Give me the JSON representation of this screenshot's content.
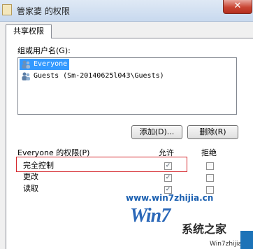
{
  "window": {
    "title": "管家婆 的权限",
    "close_label": "✕"
  },
  "tab": {
    "label": "共享权限"
  },
  "group": {
    "label": "组或用户名(G):",
    "users": [
      {
        "name": "Everyone",
        "selected": true,
        "icon": "users-group-icon"
      },
      {
        "name": "Guests (Sm-20140625l043\\Guests)",
        "selected": false,
        "icon": "users-group-icon"
      }
    ]
  },
  "buttons": {
    "add_label": "添加(D)...",
    "remove_label": "删除(R)"
  },
  "permissions": {
    "header_label": "Everyone 的权限(P)",
    "allow_header": "允许",
    "deny_header": "拒绝",
    "rows": [
      {
        "name": "完全控制",
        "allow": true,
        "deny": false
      },
      {
        "name": "更改",
        "allow": true,
        "deny": false
      },
      {
        "name": "读取",
        "allow": true,
        "deny": false
      }
    ]
  },
  "watermark": {
    "url": "www.win7zhijia.cn",
    "logo_text": "Win7",
    "logo_sub": "系统之家",
    "logo_domain": "Win7zhijia.cn"
  },
  "colors": {
    "selection": "#3399ff",
    "highlight_box": "#d5282e",
    "check": "#4a5a6a"
  }
}
